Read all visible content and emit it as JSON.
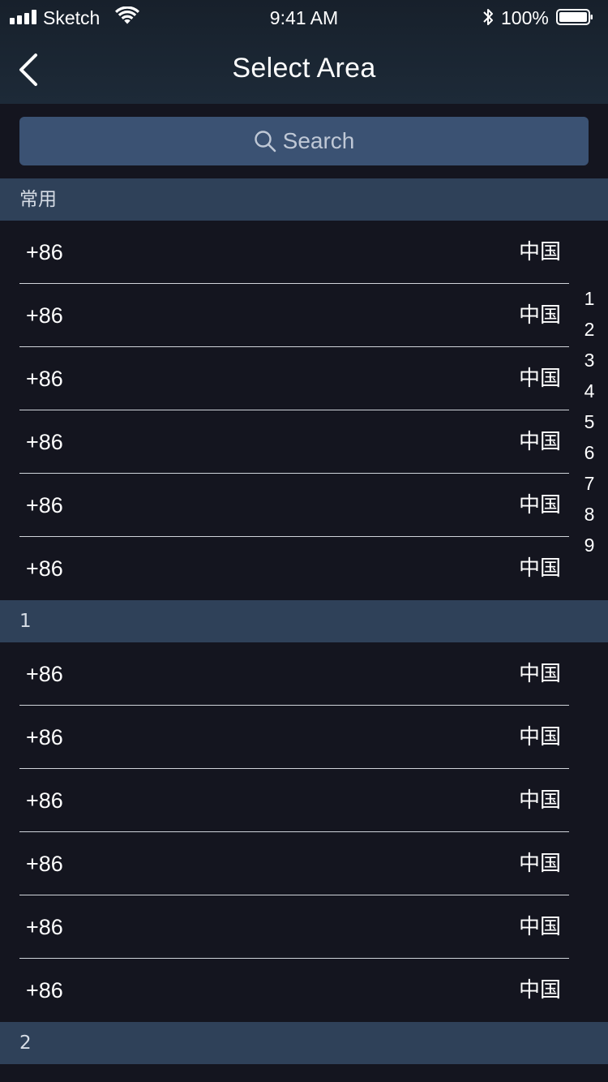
{
  "status_bar": {
    "carrier": "Sketch",
    "time": "9:41 AM",
    "battery": "100%",
    "icons": [
      "signal-icon",
      "wifi-icon",
      "bluetooth-icon",
      "battery-icon"
    ]
  },
  "nav": {
    "title": "Select Area",
    "back_icon": "chevron-left-icon"
  },
  "search": {
    "placeholder": "Search",
    "icon": "search-icon"
  },
  "colors": {
    "background": "#14151f",
    "header": "#1d2a38",
    "search_box": "#3b5273",
    "section_header": "#2f4159",
    "text": "#ffffff"
  },
  "sections": [
    {
      "title": "常用",
      "rows": [
        {
          "code": "+86",
          "country": "中国"
        },
        {
          "code": "+86",
          "country": "中国"
        },
        {
          "code": "+86",
          "country": "中国"
        },
        {
          "code": "+86",
          "country": "中国"
        },
        {
          "code": "+86",
          "country": "中国"
        },
        {
          "code": "+86",
          "country": "中国"
        }
      ]
    },
    {
      "title": "1",
      "rows": [
        {
          "code": "+86",
          "country": "中国"
        },
        {
          "code": "+86",
          "country": "中国"
        },
        {
          "code": "+86",
          "country": "中国"
        },
        {
          "code": "+86",
          "country": "中国"
        },
        {
          "code": "+86",
          "country": "中国"
        },
        {
          "code": "+86",
          "country": "中国"
        }
      ]
    },
    {
      "title": "2",
      "rows": []
    }
  ],
  "index": [
    "1",
    "2",
    "3",
    "4",
    "5",
    "6",
    "7",
    "8",
    "9"
  ]
}
